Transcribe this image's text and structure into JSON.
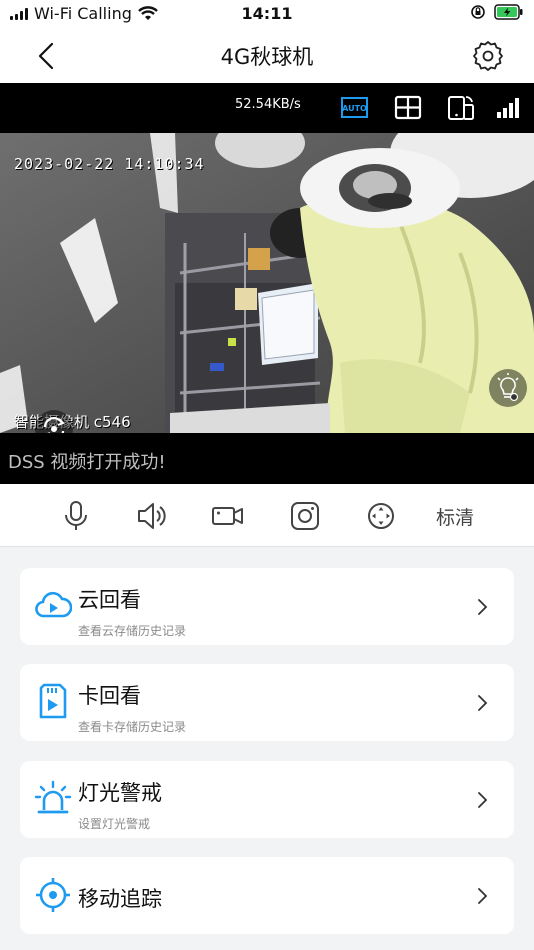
{
  "status_bar": {
    "carrier": "Wi-Fi Calling",
    "time": "14:11"
  },
  "header": {
    "title": "4G秋球机",
    "back_icon": "chevron-left-icon",
    "settings_icon": "gear-icon"
  },
  "video_toolbar": {
    "bitrate": "52.54KB/s",
    "auto_label": "AUTO",
    "icons": [
      "auto-mode-icon",
      "grid-layout-icon",
      "rotate-screen-icon",
      "signal-strength-icon"
    ]
  },
  "video": {
    "timestamp": "2023-02-22  14:10:34",
    "camera_name": "智能摄像机 c546"
  },
  "message": "DSS 视频打开成功!",
  "controls": {
    "icons": [
      "microphone-icon",
      "speaker-icon",
      "record-video-icon",
      "snapshot-icon",
      "ptz-crosshair-icon"
    ],
    "quality_label": "标清"
  },
  "accent_color": "#1e9bf0",
  "cards": [
    {
      "title": "云回看",
      "subtitle": "查看云存储历史记录",
      "icon": "cloud-play-icon"
    },
    {
      "title": "卡回看",
      "subtitle": "查看卡存储历史记录",
      "icon": "sd-card-icon"
    },
    {
      "title": "灯光警戒",
      "subtitle": "设置灯光警戒",
      "icon": "alarm-light-icon"
    },
    {
      "title": "移动追踪",
      "subtitle": "",
      "icon": "motion-tracking-icon"
    }
  ]
}
